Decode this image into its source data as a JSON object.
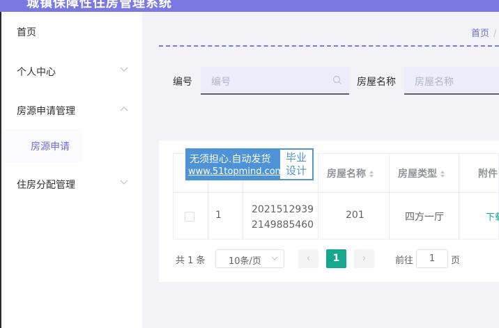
{
  "header": {
    "title": "城镇保障性住房管理系统"
  },
  "sidebar": {
    "items": [
      {
        "label": "首页"
      },
      {
        "label": "个人中心"
      },
      {
        "label": "房源申请管理"
      },
      {
        "label": "房源申请"
      },
      {
        "label": "住房分配管理"
      }
    ]
  },
  "breadcrumb": {
    "home": "首页"
  },
  "search": {
    "field1_label": "编号",
    "field1_placeholder": "编号",
    "field2_label": "房屋名称",
    "field2_placeholder": "房屋名称"
  },
  "table": {
    "headers": [
      "房屋名称",
      "房屋类型",
      "附件"
    ],
    "rows": [
      {
        "index": "1",
        "number_line1": "2021512939",
        "number_line2": "2149885460",
        "house_name": "201",
        "house_type": "四方一厅",
        "attachment": "下载"
      }
    ]
  },
  "watermark": {
    "line1": "无须担心.自动发货",
    "line2": "www.51topmind.com",
    "box_line1": "毕业",
    "box_line2": "设计"
  },
  "pagination": {
    "total": "共 1 条",
    "page_size": "10条/页",
    "current_page": "1",
    "goto_prefix": "前往",
    "goto_value": "1",
    "goto_suffix": "页"
  },
  "colors": {
    "accent": "#7b77e3",
    "active_page": "#16a78e",
    "watermark": "#4d93d6"
  }
}
